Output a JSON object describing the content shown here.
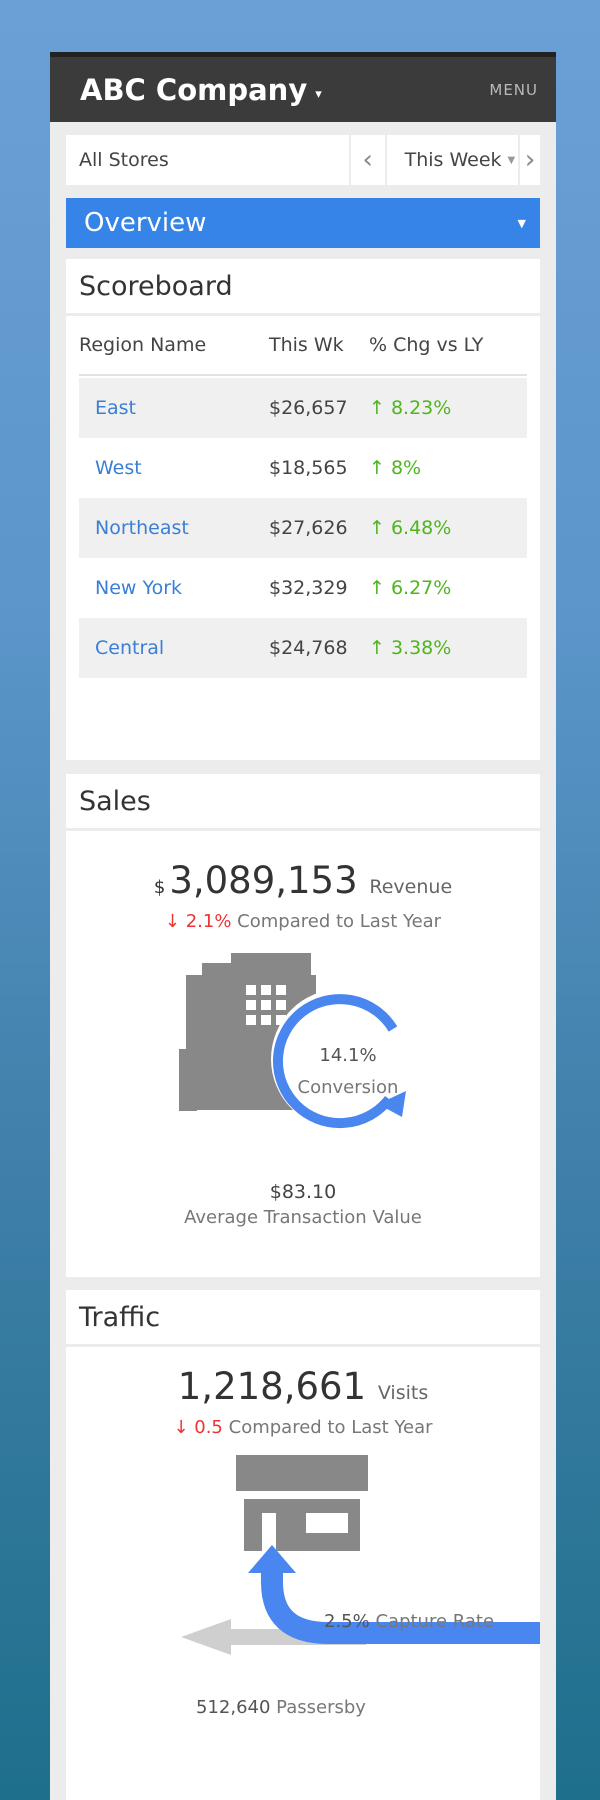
{
  "header": {
    "title": "ABC Company",
    "menu_label": "MENU"
  },
  "filters": {
    "store": "All Stores",
    "period": "This Week"
  },
  "section_selector": {
    "label": "Overview"
  },
  "scoreboard": {
    "title": "Scoreboard",
    "columns": [
      "Region Name",
      "This Wk",
      "% Chg vs LY"
    ],
    "rows": [
      {
        "region": "East",
        "this_week": "$26,657",
        "change": "8.23%"
      },
      {
        "region": "West",
        "this_week": "$18,565",
        "change": "8%"
      },
      {
        "region": "Northeast",
        "this_week": "$27,626",
        "change": "6.48%"
      },
      {
        "region": "New York",
        "this_week": "$32,329",
        "change": "6.27%"
      },
      {
        "region": "Central",
        "this_week": "$24,768",
        "change": "3.38%"
      }
    ]
  },
  "sales": {
    "title": "Sales",
    "currency_symbol": "$",
    "revenue": "3,089,153",
    "revenue_label": "Revenue",
    "change": "2.1%",
    "compare_label": "Compared to Last Year",
    "conversion": "14.1%",
    "conversion_label": "Conversion",
    "avg_transaction": "$83.10",
    "avg_transaction_label": "Average Transaction Value"
  },
  "traffic": {
    "title": "Traffic",
    "visits": "1,218,661",
    "visits_label": "Visits",
    "change": "0.5",
    "compare_label": "Compared to Last Year",
    "capture_rate": "2.5%",
    "capture_rate_label": "Capture Rate",
    "passersby": "512,640",
    "passersby_label": "Passersby"
  },
  "colors": {
    "accent": "#3684e8",
    "positive": "#4fb51f",
    "negative": "#e33333",
    "link": "#3a7fd5"
  }
}
